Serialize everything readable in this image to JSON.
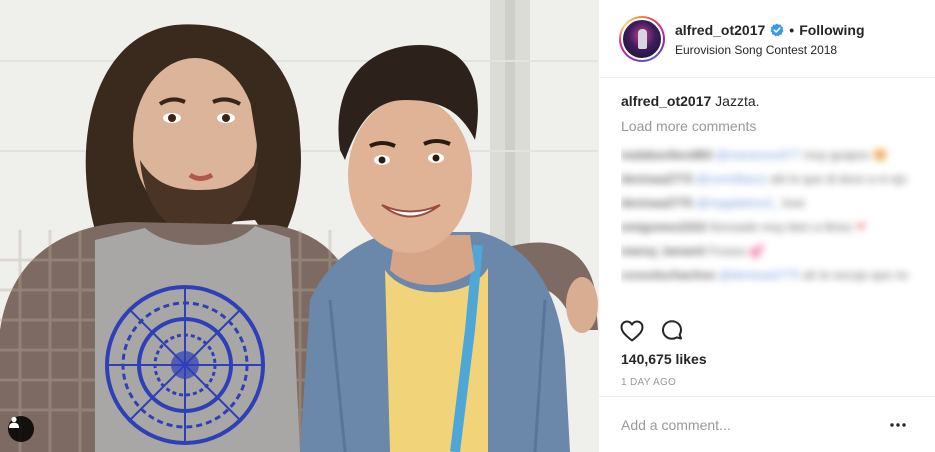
{
  "post": {
    "username": "alfred_ot2017",
    "separator": "•",
    "follow_label": "Following",
    "location": "Eurovision Song Contest 2018",
    "caption_user": "alfred_ot2017",
    "caption_text": "Jazzta.",
    "load_more": "Load more comments",
    "likes": "140,675 likes",
    "timestamp": "1 DAY AGO",
    "add_comment_placeholder": "Add a comment..."
  },
  "comments": [
    {
      "user": "malakavibes883",
      "mention": "@maranoxx077",
      "text": "muy guapos",
      "emoji": "😍"
    },
    {
      "user": "denisaa2773",
      "mention": "@cormillazzz",
      "text": "ahi lo que di doce a ni ojo",
      "emoji": ""
    },
    {
      "user": "denisaa2775",
      "mention": "@mygalahos2_",
      "text": "love",
      "emoji": ""
    },
    {
      "user": "emigomez2222",
      "mention": "",
      "text": "Ilorssado muy bien a illvixz",
      "emoji": "❤"
    },
    {
      "user": "manuj_lamanit",
      "mention": "",
      "text": "Fruuuu",
      "emoji": "💕"
    },
    {
      "user": "cossoluchachoo",
      "mention": "@denisaa2775",
      "text": "ah te escujo que no",
      "emoji": ""
    }
  ],
  "icons": {
    "verified": "verified-badge-icon",
    "like": "heart-icon",
    "comment": "comment-bubble-icon",
    "options": "more-options-icon",
    "tag": "user-tag-icon"
  },
  "colors": {
    "verified_blue": "#3897f0",
    "muted_text": "#999999",
    "primary_text": "#262626"
  }
}
